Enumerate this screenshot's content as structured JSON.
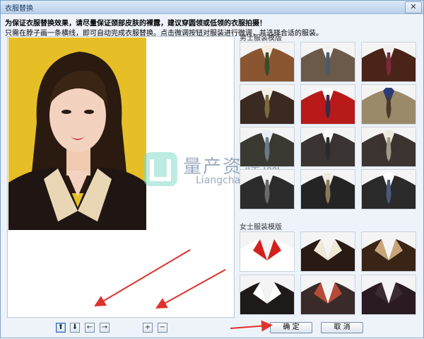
{
  "window": {
    "title": "衣服替换",
    "close_glyph": "✕"
  },
  "hints": {
    "line1": "为保证衣服替换效果，请尽量保证颈部皮肤的裸露，建议穿圆领或低领的衣服拍摄！",
    "line2": "只需在脖子画一条横线，即可自动完成衣服替换。点击微调按钮对服装进行微调，并选择合适的服装。"
  },
  "male_section": {
    "title": "男士服装模版",
    "items": [
      {
        "suit": "#8a5632",
        "shirt": "#f4ede0",
        "tie": "#3a4a2a"
      },
      {
        "suit": "#6b5a4a",
        "shirt": "#f2f2ee",
        "tie": "#4a5a6a"
      },
      {
        "suit": "#4a2418",
        "shirt": "#f3eeee",
        "tie": "#7a2a3a"
      },
      {
        "suit": "#3a2a22",
        "shirt": "#f2efe6",
        "tie": "#7a6a3a"
      },
      {
        "suit": "#b81a1a",
        "shirt": "#ffffff",
        "tie": "#3a2a4a"
      },
      {
        "suit": "#9a8a6a",
        "shirt": "#2a3a7a",
        "tie": "#4a3a2a"
      },
      {
        "suit": "#3a3a33",
        "shirt": "#e9ecf2",
        "tie": "#6a7a8a"
      },
      {
        "suit": "#3a3432",
        "shirt": "#ffffff",
        "tie": "#2a2a2a"
      },
      {
        "suit": "#3b3430",
        "shirt": "#eee9dd",
        "tie": "#a09a8a"
      },
      {
        "suit": "#2c2c2c",
        "shirt": "#f2f2f2",
        "tie": "#6a6a6a"
      },
      {
        "suit": "#242424",
        "shirt": "#efeadf",
        "tie": "#8a7a5a"
      },
      {
        "suit": "#2a2a2a",
        "shirt": "#ffffff",
        "tie": "#4a5a7a"
      }
    ]
  },
  "female_section": {
    "title": "女士服装模版",
    "items": [
      {
        "suit": "#ffffff",
        "collar": "#d4201c"
      },
      {
        "suit": "#2a1a14",
        "collar": "#f2e8d6"
      },
      {
        "suit": "#3a2416",
        "collar": "#c9a67a"
      },
      {
        "suit": "#1e1a1a",
        "collar": "#ffffff"
      },
      {
        "suit": "#3a2a2a",
        "collar": "#b84a3a"
      },
      {
        "suit": "#2a1a24",
        "collar": "#3a2a34"
      }
    ]
  },
  "toolbar": {
    "move_up": "⬆",
    "move_down": "⬇",
    "move_left": "←",
    "move_right": "→",
    "zoom_in": "+",
    "zoom_out": "−",
    "confirm": "确 定",
    "cancel": "取 消"
  },
  "watermark": {
    "cn": "量产资源网",
    "en": "Liangchan.net"
  },
  "colors": {
    "accent_arrow": "#e0322c",
    "portrait_bg": "#e6bf27",
    "jacket": "#1f1614",
    "collar": "#e9d6b5"
  }
}
